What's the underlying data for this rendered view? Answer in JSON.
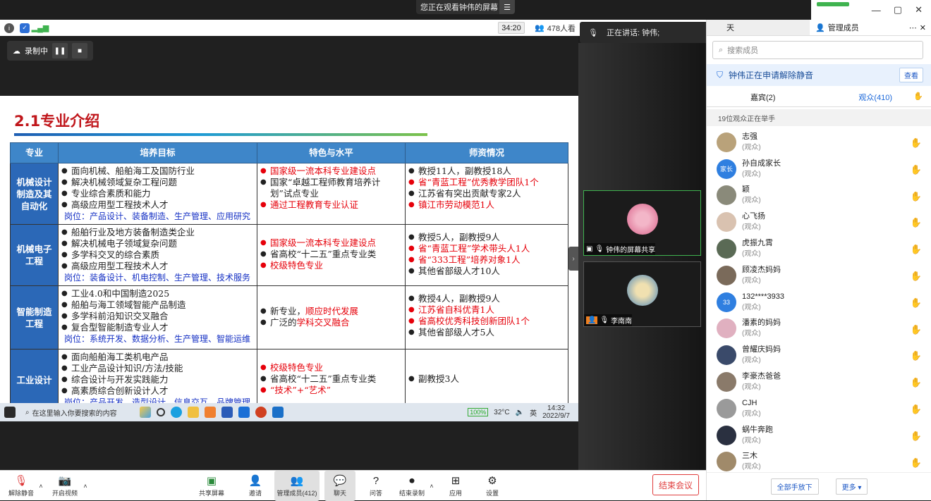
{
  "banner": {
    "text": "您正在观看钟伟的屏幕",
    "menu_icon": "menu-icon"
  },
  "window": {
    "minimize": "—",
    "restore": "▢",
    "close": "✕"
  },
  "infobar": {
    "timer": "34:20",
    "viewers": "478人看",
    "speaker": "正在讲话: 钟伟;"
  },
  "recording": {
    "label": "录制中"
  },
  "slide": {
    "title": "2.1专业介绍",
    "headers": [
      "专业",
      "培养目标",
      "特色与水平",
      "师资情况"
    ],
    "rows": [
      {
        "major": "机械设计制造及其自动化",
        "goals": [
          "面向机械、船舶海工及国防行业",
          "解决机械领域复杂工程问题",
          "专业综合素质和能力",
          "高级应用型工程技术人才"
        ],
        "positions": "岗位：产品设计、装备制造、生产管理、应用研究",
        "features": [
          {
            "text": "国家级一流本科专业建设点",
            "red": true
          },
          {
            "text": "国家“卓越工程师教育培养计划”试点专业",
            "red": false
          },
          {
            "text": "通过工程教育专业认证",
            "red": true
          }
        ],
        "faculty": [
          {
            "text": "教授11人，副教授18人",
            "red": false
          },
          {
            "text": "省“青蓝工程”优秀教学团队1个",
            "red": true
          },
          {
            "text": "江苏省有突出贡献专家2人",
            "red": false
          },
          {
            "text": "镇江市劳动模范1人",
            "red": true
          }
        ]
      },
      {
        "major": "机械电子工程",
        "goals": [
          "船舶行业及地方装备制造类企业",
          "解决机械电子领域复杂问题",
          "多学科交叉的综合素质",
          "高级应用型工程技术人才"
        ],
        "positions": "岗位：装备设计、机电控制、生产管理、技术服务",
        "features": [
          {
            "text": "国家级一流本科专业建设点",
            "red": true
          },
          {
            "text": "省高校“十二五”重点专业类",
            "red": false
          },
          {
            "text": "校级特色专业",
            "red": true
          }
        ],
        "faculty": [
          {
            "text": "教授5人，副教授9人",
            "red": false
          },
          {
            "text": "省“青蓝工程”学术带头人1人",
            "red": true
          },
          {
            "text": "省“333工程”培养对象1人",
            "red": true
          },
          {
            "text": "其他省部级人才10人",
            "red": false
          }
        ]
      },
      {
        "major": "智能制造工程",
        "goals": [
          "工业4.0和中国制造2025",
          "船舶与海工领域智能产品制造",
          "多学科前沿知识交叉融合",
          "复合型智能制造专业人才"
        ],
        "positions": "岗位：系统开发、数据分析、生产管理、智能运维",
        "features_prefix": [
          "新专业，",
          "广泛的"
        ],
        "features_red": [
          "顺应时代发展",
          "学科交叉融合"
        ],
        "faculty": [
          {
            "text": "教授4人，副教授9人",
            "red": false
          },
          {
            "text": "江苏省自科优青1人",
            "red": true
          },
          {
            "text": "省高校优秀科技创新团队1个",
            "red": true
          },
          {
            "text": "其他省部级人才5人",
            "red": false
          }
        ]
      },
      {
        "major": "工业设计",
        "goals": [
          "面向船舶海工类机电产品",
          "工业产品设计知识/方法/技能",
          "综合设计与开发实践能力",
          "高素质综合创新设计人才"
        ],
        "positions": "岗位：产品开发、造型设计、信息交互、品牌管理",
        "features": [
          {
            "text": "校级特色专业",
            "red": true
          },
          {
            "text": "省高校“十二五”重点专业类",
            "red": false
          },
          {
            "text": "“技术”+“艺术”",
            "red": true
          }
        ],
        "faculty": [
          {
            "text": "副教授3人",
            "red": false
          }
        ]
      }
    ]
  },
  "taskbar": {
    "search_placeholder": "在这里输入你要搜索的内容",
    "battery": "100%",
    "weather": "32°C",
    "lang": "英",
    "time": "14:32",
    "date": "2022/9/7"
  },
  "videos": [
    {
      "name": "钟伟的屏幕共享"
    },
    {
      "name": "李南南"
    }
  ],
  "panel": {
    "tab_chat": "天",
    "tab_manage": "管理成员",
    "search_placeholder": "搜索成员",
    "unmute_notice": "钟伟正在申请解除静音",
    "unmute_view": "查看",
    "guests_tab": "嘉宾(2)",
    "audience_tab": "观众(410)",
    "raising": "19位观众正在举手",
    "role": "(观众)",
    "members": [
      {
        "name": "志强",
        "color": "#b9a27a",
        "tag": ""
      },
      {
        "name": "孙自成家长",
        "color": "#2f7fe0",
        "tag": "家长"
      },
      {
        "name": "颖",
        "color": "#8a8a7a",
        "tag": ""
      },
      {
        "name": "心飞扬",
        "color": "#d9c2b0",
        "tag": ""
      },
      {
        "name": "虎振九霄",
        "color": "#5a6a55",
        "tag": ""
      },
      {
        "name": "顾凌杰妈妈",
        "color": "#7a6a5a",
        "tag": ""
      },
      {
        "name": "132****3933",
        "color": "#2f7fe0",
        "tag": "33"
      },
      {
        "name": "潘素的妈妈",
        "color": "#e0b0c0",
        "tag": ""
      },
      {
        "name": "曾耀庆妈妈",
        "color": "#3a4a6a",
        "tag": ""
      },
      {
        "name": "李豪杰爸爸",
        "color": "#8a7a6a",
        "tag": ""
      },
      {
        "name": "CJH",
        "color": "#9a9a9a",
        "tag": ""
      },
      {
        "name": "蜗牛奔跑",
        "color": "#2a3040",
        "tag": ""
      },
      {
        "name": "三木",
        "color": "#a08a6a",
        "tag": ""
      }
    ],
    "lower_all": "全部手放下",
    "more": "更多 ▾"
  },
  "toolbar": {
    "unmute": "解除静音",
    "video": "开启视频",
    "share": "共享屏幕",
    "invite": "邀请",
    "manage": "管理成员(412)",
    "chat": "聊天",
    "qa": "问答",
    "end_record": "结束录制",
    "apps": "应用",
    "settings": "设置",
    "end_meeting": "结束会议"
  }
}
